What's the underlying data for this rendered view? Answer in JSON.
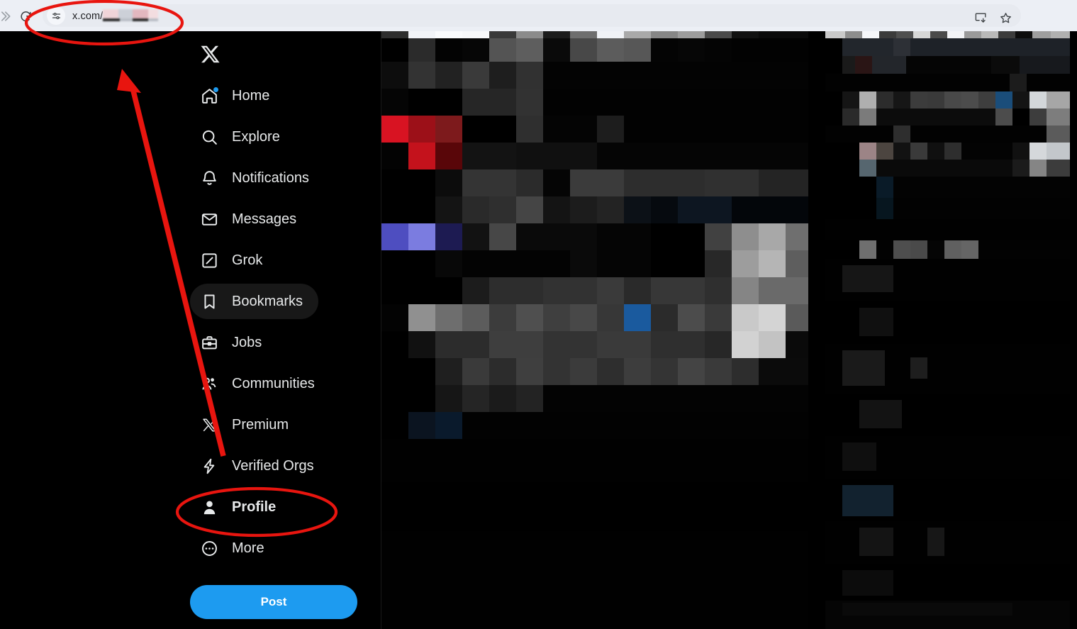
{
  "browser": {
    "forward_icon": "forward-chevron-icon",
    "reload_icon": "reload-icon",
    "site_settings_icon": "site-settings-sliders-icon",
    "url_prefix": "x.com/",
    "url_redacted": true,
    "install_icon": "install-app-icon",
    "bookmark_icon": "bookmark-star-icon"
  },
  "sidebar": {
    "logo": "x-logo-icon",
    "items": [
      {
        "label": "Home",
        "icon": "home-icon",
        "active": false,
        "bold": false,
        "badge": true
      },
      {
        "label": "Explore",
        "icon": "search-icon",
        "active": false,
        "bold": false,
        "badge": false
      },
      {
        "label": "Notifications",
        "icon": "bell-icon",
        "active": false,
        "bold": false,
        "badge": false
      },
      {
        "label": "Messages",
        "icon": "envelope-icon",
        "active": false,
        "bold": false,
        "badge": false
      },
      {
        "label": "Grok",
        "icon": "grok-slash-icon",
        "active": false,
        "bold": false,
        "badge": false
      },
      {
        "label": "Bookmarks",
        "icon": "bookmark-icon",
        "active": true,
        "bold": false,
        "badge": false
      },
      {
        "label": "Jobs",
        "icon": "briefcase-icon",
        "active": false,
        "bold": false,
        "badge": false
      },
      {
        "label": "Communities",
        "icon": "communities-icon",
        "active": false,
        "bold": false,
        "badge": false
      },
      {
        "label": "Premium",
        "icon": "x-premium-icon",
        "active": false,
        "bold": false,
        "badge": false
      },
      {
        "label": "Verified Orgs",
        "icon": "lightning-bolt-icon",
        "active": false,
        "bold": false,
        "badge": false
      },
      {
        "label": "Profile",
        "icon": "person-filled-icon",
        "active": false,
        "bold": true,
        "badge": false
      },
      {
        "label": "More",
        "icon": "more-dots-icon",
        "active": false,
        "bold": false,
        "badge": false
      }
    ],
    "post_button": "Post"
  },
  "annotations": {
    "color": "#e8150f",
    "url_ellipse": "red-ellipse-around-url-bar",
    "profile_ellipse": "red-ellipse-around-profile",
    "arrow": "red-arrow-from-sidebar-to-url-bar"
  },
  "content": {
    "redacted": true,
    "description": "pixelated-redacted-timeline"
  },
  "colors": {
    "accent_blue": "#1d9bf0",
    "page_background": "#000000",
    "text_primary": "#e7e9ea",
    "active_pill": "#181818",
    "browser_chrome": "#eceff5",
    "annotation_red": "#e8150f"
  }
}
